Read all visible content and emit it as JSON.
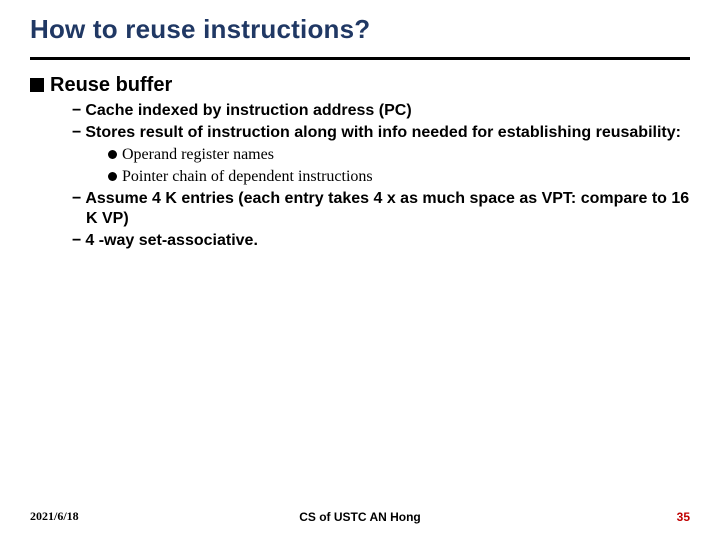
{
  "title": "How to reuse instructions?",
  "lvl1": "Reuse buffer",
  "lvl2": {
    "a": "Cache indexed by instruction address (PC)",
    "b": "Stores result of instruction along with info needed for establishing reusability:",
    "c": "Assume 4 K entries (each entry takes 4 x as much space as VPT: compare to 16 K VP)",
    "d": "4 -way set-associative."
  },
  "lvl3": {
    "a": "Operand register names",
    "b": "Pointer chain of dependent instructions"
  },
  "footer": {
    "date": "2021/6/18",
    "center": "CS of USTC AN Hong",
    "pageno": "35"
  }
}
